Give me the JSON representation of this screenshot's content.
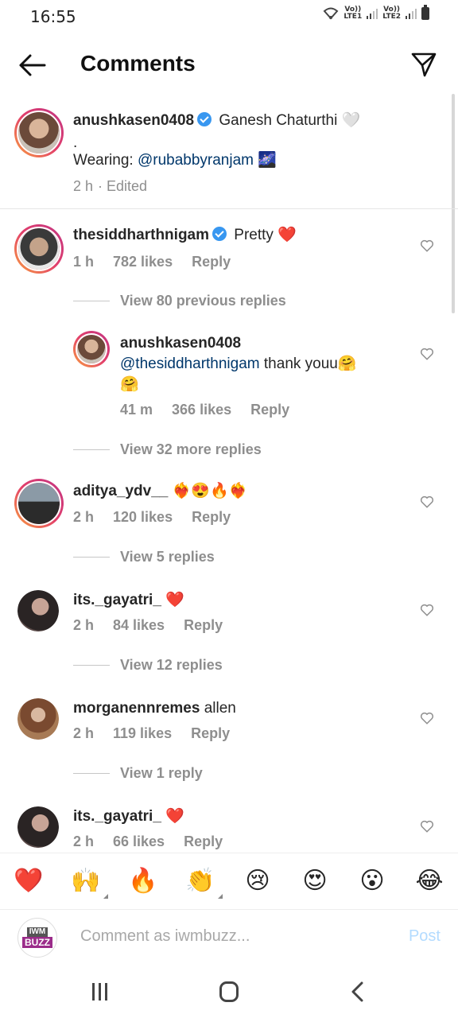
{
  "status_bar": {
    "time": "16:55",
    "sim1": "LTE1",
    "sim2": "LTE2",
    "volte": "Vo))"
  },
  "header": {
    "title": "Comments"
  },
  "caption": {
    "username": "anushkasen0408",
    "text": "Ganesh Chaturthi 🤍",
    "line2": ".",
    "line3_prefix": "Wearing: ",
    "line3_mention": "@rubabbyranjam",
    "line3_suffix": " 🌌",
    "time": "2 h",
    "edited": "· Edited"
  },
  "comments": [
    {
      "username": "thesiddharthnigam",
      "text": "Pretty ❤️",
      "time": "1 h",
      "likes": "782 likes",
      "reply": "Reply",
      "view_replies": "View 80 previous replies"
    },
    {
      "username": "anushkasen0408",
      "mention": "@thesiddharthnigam",
      "text": " thank youu🤗",
      "text2": "🤗",
      "time": "41 m",
      "likes": "366 likes",
      "reply": "Reply",
      "view_replies": "View 32 more replies"
    },
    {
      "username": "aditya_ydv__",
      "text": "❤️‍🔥😍🔥❤️‍🔥",
      "time": "2 h",
      "likes": "120 likes",
      "reply": "Reply",
      "view_replies": "View 5 replies"
    },
    {
      "username": "its._gayatri_",
      "text": "❤️",
      "time": "2 h",
      "likes": "84 likes",
      "reply": "Reply",
      "view_replies": "View 12 replies"
    },
    {
      "username": "morganennremes",
      "text": " allen",
      "time": "2 h",
      "likes": "119 likes",
      "reply": "Reply",
      "view_replies": "View 1 reply"
    },
    {
      "username": "its._gayatri_",
      "text": "❤️",
      "time": "2 h",
      "likes": "66 likes",
      "reply": "Reply"
    }
  ],
  "emoji_bar": [
    "❤️",
    "🙌",
    "🔥",
    "👏",
    "😢",
    "😍",
    "😮",
    "😂"
  ],
  "input": {
    "placeholder": "Comment as iwmbuzz...",
    "post_label": "Post",
    "avatar_line1": "IWM",
    "avatar_line2": "BUZZ"
  },
  "colors": {
    "link": "#00376b",
    "muted": "#8e8e8e",
    "verified": "#3897f0",
    "post_disabled": "#b3dbff"
  }
}
